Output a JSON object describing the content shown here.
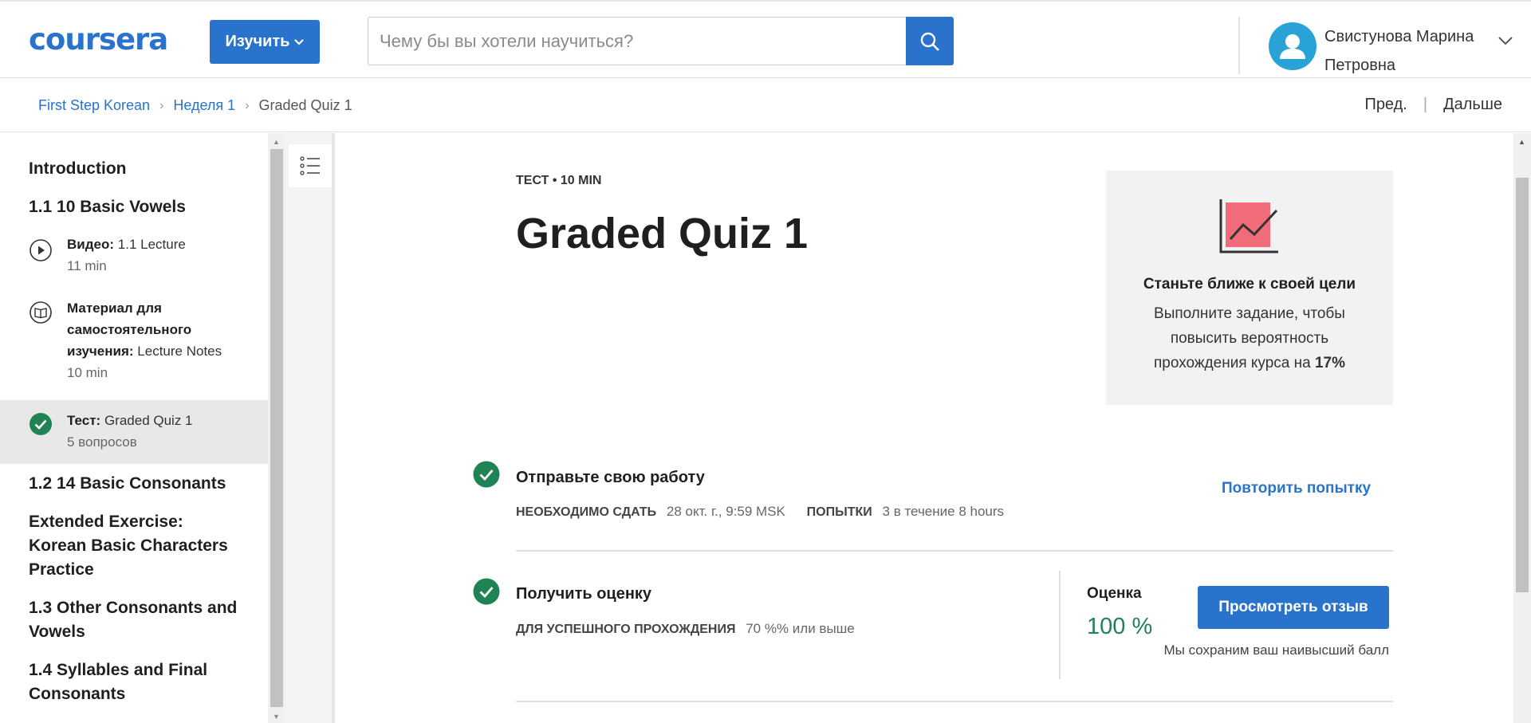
{
  "header": {
    "logo": "coursera",
    "explore_label": "Изучить",
    "search_placeholder": "Чему бы вы хотели научиться?",
    "user_name_line1": "Свистунова Марина",
    "user_name_line2": "Петровна"
  },
  "breadcrumb": {
    "items": [
      "First Step Korean",
      "Неделя 1",
      "Graded Quiz 1"
    ],
    "prev": "Пред.",
    "next": "Дальше"
  },
  "sidebar": {
    "sections": [
      "Introduction",
      "1.1 10 Basic Vowels",
      "1.2 14 Basic Consonants",
      "Extended Exercise: Korean Basic Characters Practice",
      "1.3 Other Consonants and Vowels",
      "1.4 Syllables and Final Consonants"
    ],
    "items": [
      {
        "type_label": "Видео:",
        "name": "1.1 Lecture",
        "detail": "11 min",
        "icon": "play-icon"
      },
      {
        "type_label": "Материал для самостоятельного изучения:",
        "name": "Lecture Notes",
        "detail": "10 min",
        "icon": "book-icon"
      },
      {
        "type_label": "Тест:",
        "name": "Graded Quiz 1",
        "detail": "5 вопросов",
        "icon": "check-circle-icon"
      }
    ]
  },
  "main": {
    "kicker": "ТЕСТ • 10 MIN",
    "title": "Graded Quiz 1",
    "goal": {
      "heading": "Станьте ближе к своей цели",
      "text": "Выполните задание, чтобы повысить вероятность прохождения курса на",
      "percent": "17%"
    },
    "submit": {
      "title": "Отправьте свою работу",
      "due_label": "НЕОБХОДИМО СДАТЬ",
      "due_value": "28 окт. г., 9:59 MSK",
      "attempts_label": "ПОПЫТКИ",
      "attempts_value": "3 в течение 8 hours",
      "retry_label": "Повторить попытку"
    },
    "grade": {
      "title": "Получить оценку",
      "pass_label": "ДЛЯ УСПЕШНОГО ПРОХОЖДЕНИЯ",
      "pass_value": "70 %% или выше",
      "grade_label": "Оценка",
      "grade_value": "100 %",
      "review_label": "Просмотреть отзыв",
      "best_note": "Мы сохраним ваш наивысший балл"
    }
  },
  "colors": {
    "brand": "#2a73cc",
    "success": "#1f8354",
    "goal_icon": "#f26b7a"
  }
}
